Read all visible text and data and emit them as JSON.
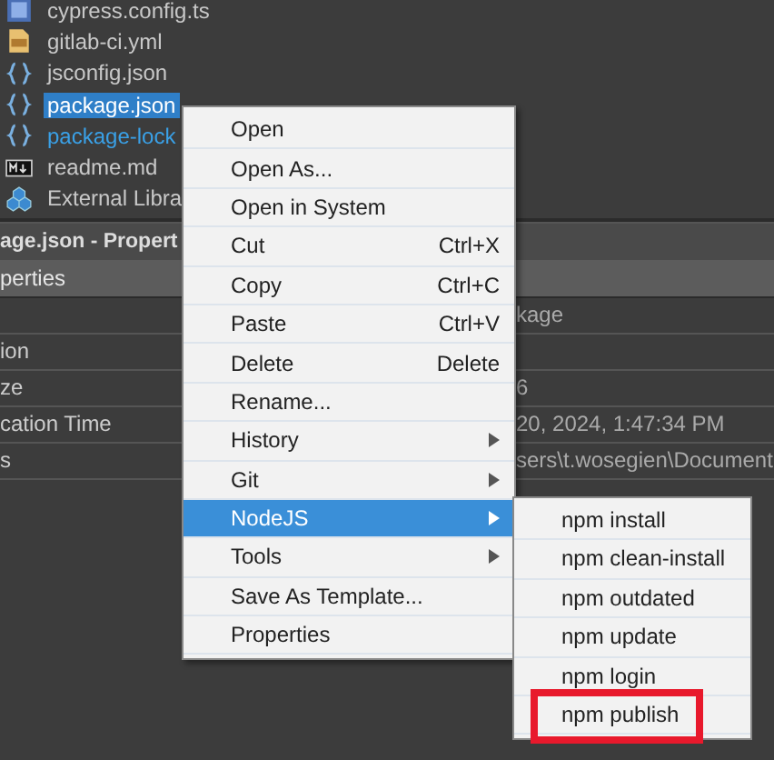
{
  "file_tree": [
    {
      "name": "cypress.config.ts",
      "kind": "ts",
      "selected": false,
      "color": "#c8c8c8"
    },
    {
      "name": "gitlab-ci.yml",
      "kind": "yml",
      "selected": false,
      "color": "#c8c8c8"
    },
    {
      "name": "jsconfig.json",
      "kind": "json",
      "selected": false,
      "color": "#c8c8c8"
    },
    {
      "name": "package.json",
      "kind": "json",
      "selected": true
    },
    {
      "name": "package-lock",
      "kind": "json",
      "selected": false,
      "color": "#3aa0e6"
    },
    {
      "name": "readme.md",
      "kind": "md",
      "selected": false,
      "color": "#c8c8c8"
    },
    {
      "name": "External Libra",
      "kind": "libraries",
      "selected": false,
      "color": "#c8c8c8"
    }
  ],
  "properties_window": {
    "title": "age.json - Propert",
    "tab": "perties",
    "rows": [
      {
        "value": "kage"
      },
      {
        "name": "ion"
      },
      {
        "name": "ze",
        "value": "6"
      },
      {
        "name": "cation Time",
        "value": "20, 2024, 1:47:34 PM"
      },
      {
        "name": "s",
        "value": "sers\\t.wosegien\\Document"
      }
    ]
  },
  "context_menu": {
    "items": [
      {
        "label": "Open",
        "selected": false
      },
      {
        "label": "Open As...",
        "selected": false
      },
      {
        "label": "Open in System",
        "selected": false
      },
      {
        "label": "Cut",
        "shortcut": "Ctrl+X",
        "selected": false
      },
      {
        "label": "Copy",
        "shortcut": "Ctrl+C",
        "selected": false
      },
      {
        "label": "Paste",
        "shortcut": "Ctrl+V",
        "selected": false
      },
      {
        "label": "Delete",
        "shortcut": "Delete",
        "selected": false
      },
      {
        "label": "Rename...",
        "selected": false
      },
      {
        "label": "History",
        "submenu": true,
        "selected": false
      },
      {
        "label": "Git",
        "submenu": true,
        "selected": false
      },
      {
        "label": "NodeJS",
        "submenu": true,
        "selected": true
      },
      {
        "label": "Tools",
        "submenu": true,
        "selected": false
      },
      {
        "label": "Save As Template...",
        "selected": false
      },
      {
        "label": "Properties",
        "selected": false
      }
    ]
  },
  "submenu": {
    "items": [
      {
        "label": "npm install",
        "highlighted": false
      },
      {
        "label": "npm clean-install",
        "highlighted": false
      },
      {
        "label": "npm outdated",
        "highlighted": false
      },
      {
        "label": "npm update",
        "highlighted": false
      },
      {
        "label": "npm login",
        "highlighted": false
      },
      {
        "label": "npm publish",
        "highlighted": true
      }
    ]
  }
}
